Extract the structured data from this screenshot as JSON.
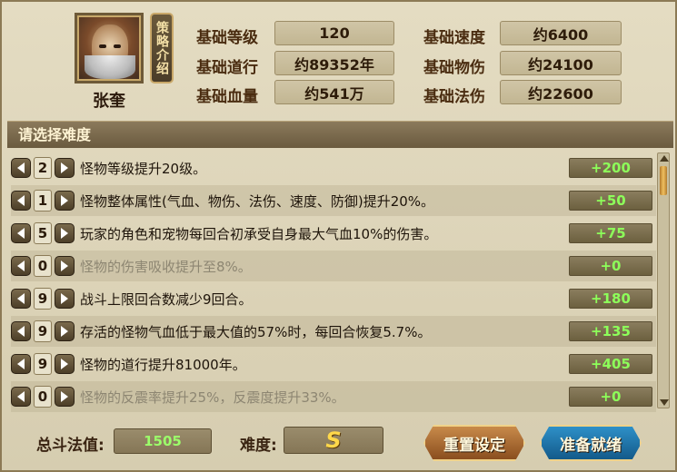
{
  "hero": {
    "name": "张奎",
    "strategy_label": "策略介绍"
  },
  "stats": {
    "level_label": "基础等级",
    "level_value": "120",
    "speed_label": "基础速度",
    "speed_value": "约6400",
    "dao_label": "基础道行",
    "dao_value": "约89352年",
    "phys_label": "基础物伤",
    "phys_value": "约24100",
    "hp_label": "基础血量",
    "hp_value": "约541万",
    "magic_label": "基础法伤",
    "magic_value": "约22600"
  },
  "panel": {
    "title": "请选择难度"
  },
  "modifiers": [
    {
      "level": "2",
      "desc": "怪物等级提升20级。",
      "bonus": "+200",
      "active": true
    },
    {
      "level": "1",
      "desc": "怪物整体属性(气血、物伤、法伤、速度、防御)提升20%。",
      "bonus": "+50",
      "active": true
    },
    {
      "level": "5",
      "desc": "玩家的角色和宠物每回合初承受自身最大气血10%的伤害。",
      "bonus": "+75",
      "active": true
    },
    {
      "level": "0",
      "desc": "怪物的伤害吸收提升至8%。",
      "bonus": "+0",
      "active": false
    },
    {
      "level": "9",
      "desc": "战斗上限回合数减少9回合。",
      "bonus": "+180",
      "active": true
    },
    {
      "level": "9",
      "desc": "存活的怪物气血低于最大值的57%时，每回合恢复5.7%。",
      "bonus": "+135",
      "active": true
    },
    {
      "level": "9",
      "desc": "怪物的道行提升81000年。",
      "bonus": "+405",
      "active": true
    },
    {
      "level": "0",
      "desc": "怪物的反震率提升25%，反震度提升33%。",
      "bonus": "+0",
      "active": false
    }
  ],
  "footer": {
    "total_label": "总斗法值:",
    "total_value": "1505",
    "difficulty_label": "难度:",
    "difficulty_value": "S",
    "reset_label": "重置设定",
    "ready_label": "准备就绪"
  },
  "colors": {
    "bonus_text": "#8dff5a",
    "difficulty_grade": "#ffd84a",
    "ready_button": "#2e90c8",
    "reset_button": "#c88a4a"
  }
}
